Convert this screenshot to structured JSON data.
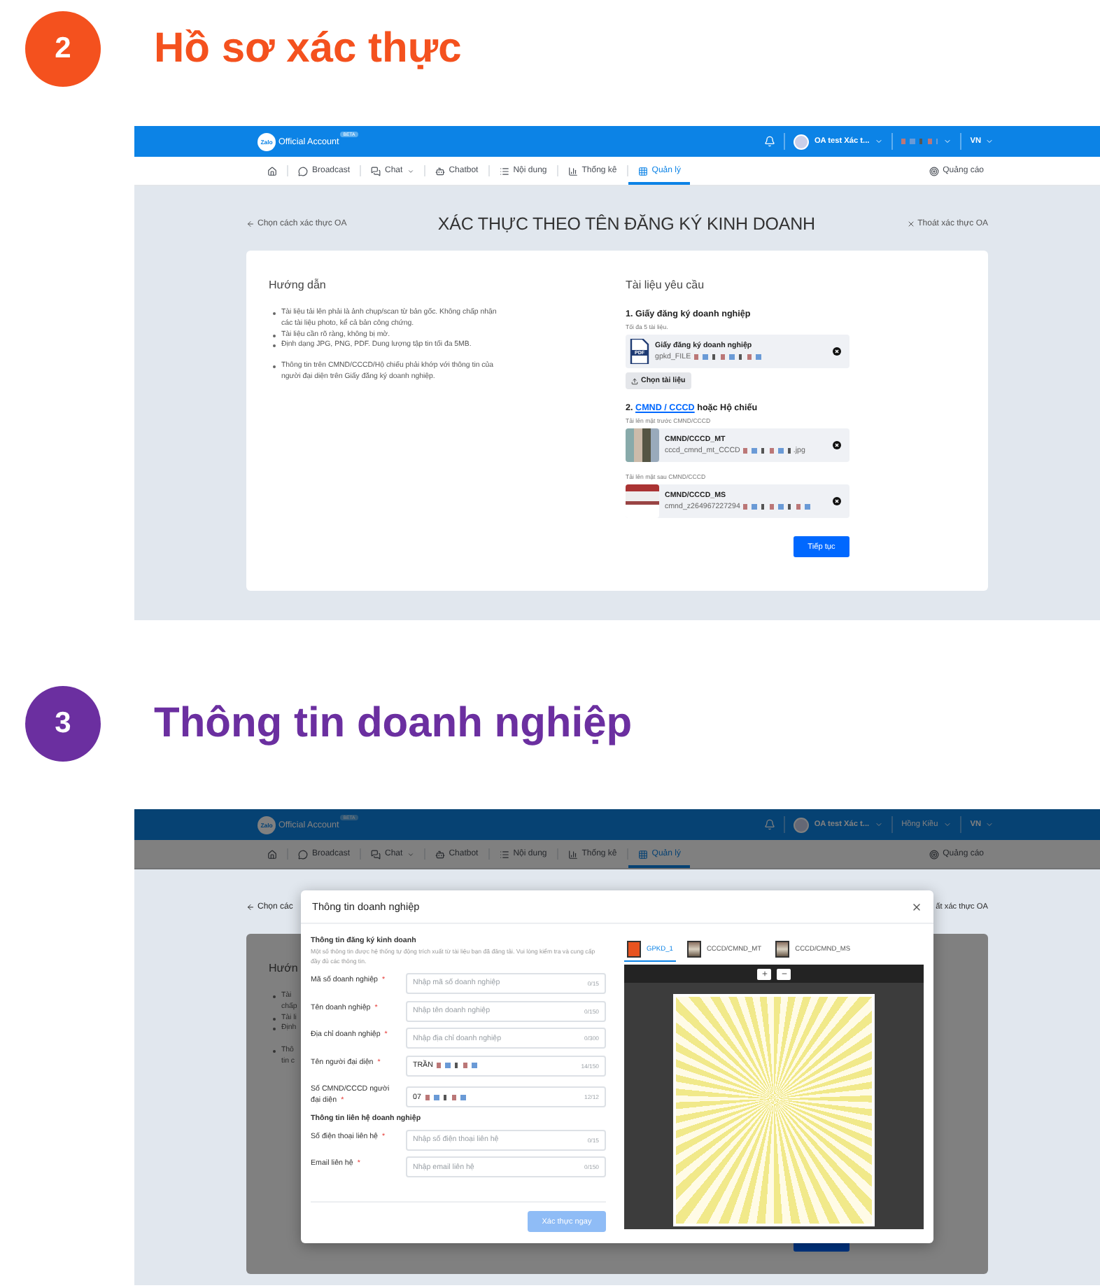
{
  "step_verification": {
    "number": "2",
    "title": "Hồ sơ xác thực",
    "color": "#f4511e"
  },
  "screen_verification": {
    "header": {
      "logo": "Zalo",
      "title": "Official Account",
      "badge": "BETA",
      "account": "OA test Xác t...",
      "language": "VN"
    },
    "nav": [
      {
        "kind": "home",
        "selected": false,
        "has_menu": false
      },
      {
        "kind": "broadcast",
        "label": "Broadcast",
        "selected": false,
        "has_menu": false
      },
      {
        "kind": "chat",
        "label": "Chat",
        "selected": false,
        "has_menu": true
      },
      {
        "kind": "chatbot",
        "label": "Chatbot",
        "selected": false,
        "has_menu": false
      },
      {
        "kind": "content",
        "label": "Nội dung",
        "selected": false,
        "has_menu": false
      },
      {
        "kind": "stats",
        "label": "Thống kê",
        "selected": false,
        "has_menu": false
      },
      {
        "kind": "manage",
        "label": "Quản lý",
        "selected": true,
        "has_menu": false
      }
    ],
    "ads": "Quảng cáo",
    "back_link": "Chọn cách xác thực OA",
    "title": "XÁC THỰC THEO TÊN ĐĂNG KÝ KINH DOANH",
    "exit_link": "Thoát xác thực OA",
    "guide": {
      "heading": "Hướng dẫn",
      "groups": [
        [
          "Tài liệu tải lên phải là ảnh chụp/scan từ bản gốc. Không chấp nhận các tài liệu photo, kể cả bản công chứng.",
          "Tài liệu cần rõ ràng, không bị mờ.",
          "Định dạng JPG, PNG, PDF. Dung lượng tập tin tối đa 5MB."
        ],
        [
          "Thông tin trên CMND/CCCD/Hộ chiếu phải khớp với thông tin của người đại diện trên Giấy đăng ký doanh nghiệp."
        ]
      ]
    },
    "documents": {
      "heading": "Tài liệu yêu cầu",
      "sections": [
        {
          "number": "1.",
          "title": "Giấy đăng ký doanh nghiệp",
          "groups": [
            {
              "note": "Tối đa 5 tài liệu.",
              "file": {
                "kind": "pdf",
                "badge": "PDF",
                "name": "Giấy đăng ký doanh nghiệp",
                "filename": "gpkd_FILE"
              }
            }
          ],
          "upload_button": "Chọn tài liệu"
        },
        {
          "number": "2.",
          "link": "CMND / CCCD",
          "title": "hoặc Hộ chiếu",
          "groups": [
            {
              "note": "Tải lên mặt trước CMND/CCCD",
              "file": {
                "kind": "photo",
                "name": "CMND/CCCD_MT",
                "filename": "cccd_cmnd_mt_CCCD",
                "ext": ".jpg"
              }
            },
            {
              "note": "Tải lên mặt sau CMND/CCCD",
              "file": {
                "kind": "photo",
                "name": "CMND/CCCD_MS",
                "filename": "cmnd_z264967227294"
              }
            }
          ]
        }
      ]
    },
    "next_button": "Tiếp tục"
  },
  "step_business_info": {
    "number": "3",
    "title": "Thông tin doanh nghiệp",
    "color": "#6b2fa0"
  },
  "screen_business_info": {
    "header": {
      "logo": "Zalo",
      "title": "Official Account",
      "badge": "BETA",
      "account": "OA test Xác t...",
      "user": "Hồng Kiều",
      "language": "VN"
    },
    "nav": [
      {
        "kind": "home",
        "selected": false,
        "has_menu": false
      },
      {
        "kind": "broadcast",
        "label": "Broadcast",
        "selected": false,
        "has_menu": false
      },
      {
        "kind": "chat",
        "label": "Chat",
        "selected": false,
        "has_menu": true
      },
      {
        "kind": "chatbot",
        "label": "Chatbot",
        "selected": false,
        "has_menu": false
      },
      {
        "kind": "content",
        "label": "Nội dung",
        "selected": false,
        "has_menu": false
      },
      {
        "kind": "stats",
        "label": "Thống kê",
        "selected": false,
        "has_menu": false
      },
      {
        "kind": "manage",
        "label": "Quản lý",
        "selected": true,
        "has_menu": false
      }
    ],
    "ads": "Quảng cáo",
    "backdrop": {
      "back_fragment": "Chọn các",
      "exit_fragment": "ất xác thực OA",
      "heading_fragment": "Hướn",
      "lines": [
        {
          "text": "Tài",
          "bullet": true
        },
        {
          "text": "chấp",
          "bullet": false
        },
        {
          "text": "Tài li",
          "bullet": true
        },
        {
          "text": "Định",
          "bullet": true
        },
        {
          "text": "Thô",
          "bullet": true
        },
        {
          "text": "tin c",
          "bullet": false
        }
      ]
    },
    "modal": {
      "title": "Thông tin doanh nghiệp",
      "sections": [
        {
          "heading": "Thông tin đăng ký kinh doanh",
          "description": "Một số thông tin được hệ thống tự động trích xuất từ tài liệu bạn đã đăng tải. Vui lòng kiểm tra và cung cấp đầy đủ các thông tin.",
          "fields": [
            {
              "label": "Mã số doanh nghiệp",
              "mark": "*",
              "placeholder": "Nhập mã số doanh nghiệp",
              "counter": "0/15"
            },
            {
              "label": "Tên doanh nghiệp",
              "mark": "*",
              "placeholder": "Nhập tên doanh nghiệp",
              "counter": "0/150"
            },
            {
              "label": "Địa chỉ doanh nghiệp",
              "mark": "*",
              "placeholder": "Nhập địa chỉ doanh nghiệp",
              "counter": "0/300"
            },
            {
              "label": "Tên người đại diện",
              "mark": "*",
              "value": "TRẦN",
              "redacted": true,
              "counter": "14/150"
            },
            {
              "label": "Số CMND/CCCD người đại diện",
              "mark": "*",
              "value": "07",
              "redacted": true,
              "counter": "12/12"
            }
          ]
        },
        {
          "heading": "Thông tin liên hệ doanh nghiệp",
          "fields": [
            {
              "label": "Số điện thoại liên hệ",
              "mark": "*",
              "placeholder": "Nhập số điện thoại liên hệ",
              "counter": "0/15"
            },
            {
              "label": "Email liên hệ",
              "mark": "*",
              "placeholder": "Nhập email liên hệ",
              "counter": "0/150"
            }
          ]
        }
      ],
      "submit_button": "Xác thực ngay",
      "submit_disabled": true,
      "preview_tabs": [
        {
          "kind": "pdf",
          "label": "GPKD_1",
          "selected": true
        },
        {
          "kind": "photo",
          "label": "CCCD/CMND_MT",
          "selected": false
        },
        {
          "kind": "photo",
          "label": "CCCD/CMND_MS",
          "selected": false
        }
      ]
    }
  }
}
